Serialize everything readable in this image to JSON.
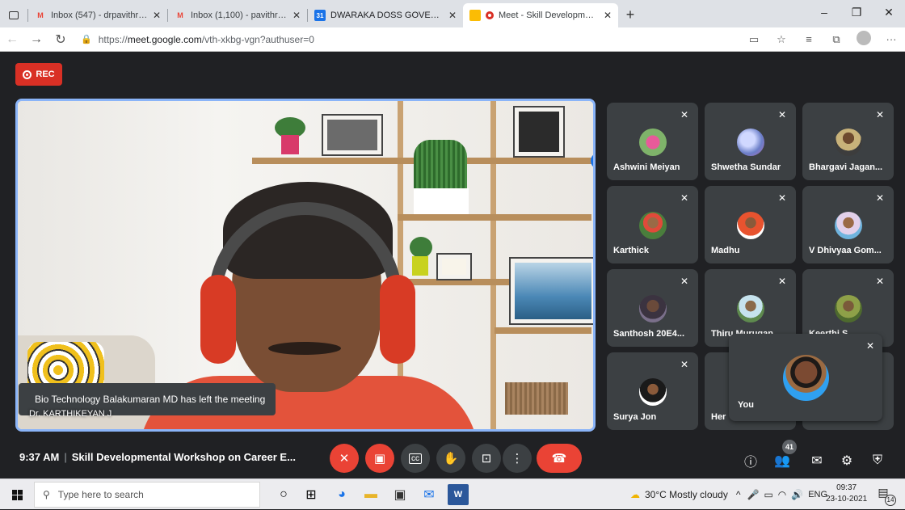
{
  "browser": {
    "tabs": [
      {
        "title": "Inbox (547) - drpavithram.dgvc@",
        "icon": "gmail-icon",
        "active": false
      },
      {
        "title": "Inbox (1,100) - pavithram@dgva",
        "icon": "gmail-icon",
        "active": false
      },
      {
        "title": "DWARAKA DOSS GOVERDHAN D",
        "icon": "calendar-icon",
        "active": false
      },
      {
        "title": "Meet - Skill Developmental",
        "icon": "meet-icon",
        "active": true
      }
    ],
    "new_tab": "+",
    "url_prefix": "https://",
    "url_host": "meet.google.com",
    "url_path": "/vth-xkbg-vgn?authuser=0",
    "window_controls": [
      "–",
      "❐",
      "✕"
    ]
  },
  "meet": {
    "rec_label": "REC",
    "main_speaker": "Dr. KARTHIKEYAN J",
    "toast": "Bio Technology Balakumaran MD has left the meeting",
    "participants": [
      {
        "name": "Ashwini Meiyan",
        "avatar_color": "#c25a7a"
      },
      {
        "name": "Shwetha Sundar",
        "avatar_color": "#8b9ad0"
      },
      {
        "name": "Bhargavi Jagan...",
        "avatar_color": "#6a5a3c"
      },
      {
        "name": "Karthick",
        "avatar_color": "#3f7a3a"
      },
      {
        "name": "Madhu",
        "avatar_color": "#e24a30"
      },
      {
        "name": "V Dhivyaa Gom...",
        "avatar_color": "#78b7d8"
      },
      {
        "name": "Santhosh 20E4...",
        "avatar_color": "#4c3a45"
      },
      {
        "name": "Thiru Murugan ...",
        "avatar_color": "#5c7d8a"
      },
      {
        "name": "Keerthi S",
        "avatar_color": "#6d7e3a"
      },
      {
        "name": "Surya Jon",
        "avatar_color": "#2a2a2a"
      },
      {
        "name": "Her",
        "avatar_color": "#555555"
      }
    ],
    "self_label": "You",
    "time": "9:37 AM",
    "meeting_title": "Skill Developmental Workshop on Career E...",
    "people_count": "41",
    "colors": {
      "danger": "#ea4335",
      "accent": "#8ab4f8",
      "rec": "#d93025"
    }
  },
  "taskbar": {
    "search_placeholder": "Type here to search",
    "weather": "30°C  Mostly cloudy",
    "lang": "ENG",
    "time": "09:37",
    "date": "23-10-2021",
    "notifications": "14"
  }
}
